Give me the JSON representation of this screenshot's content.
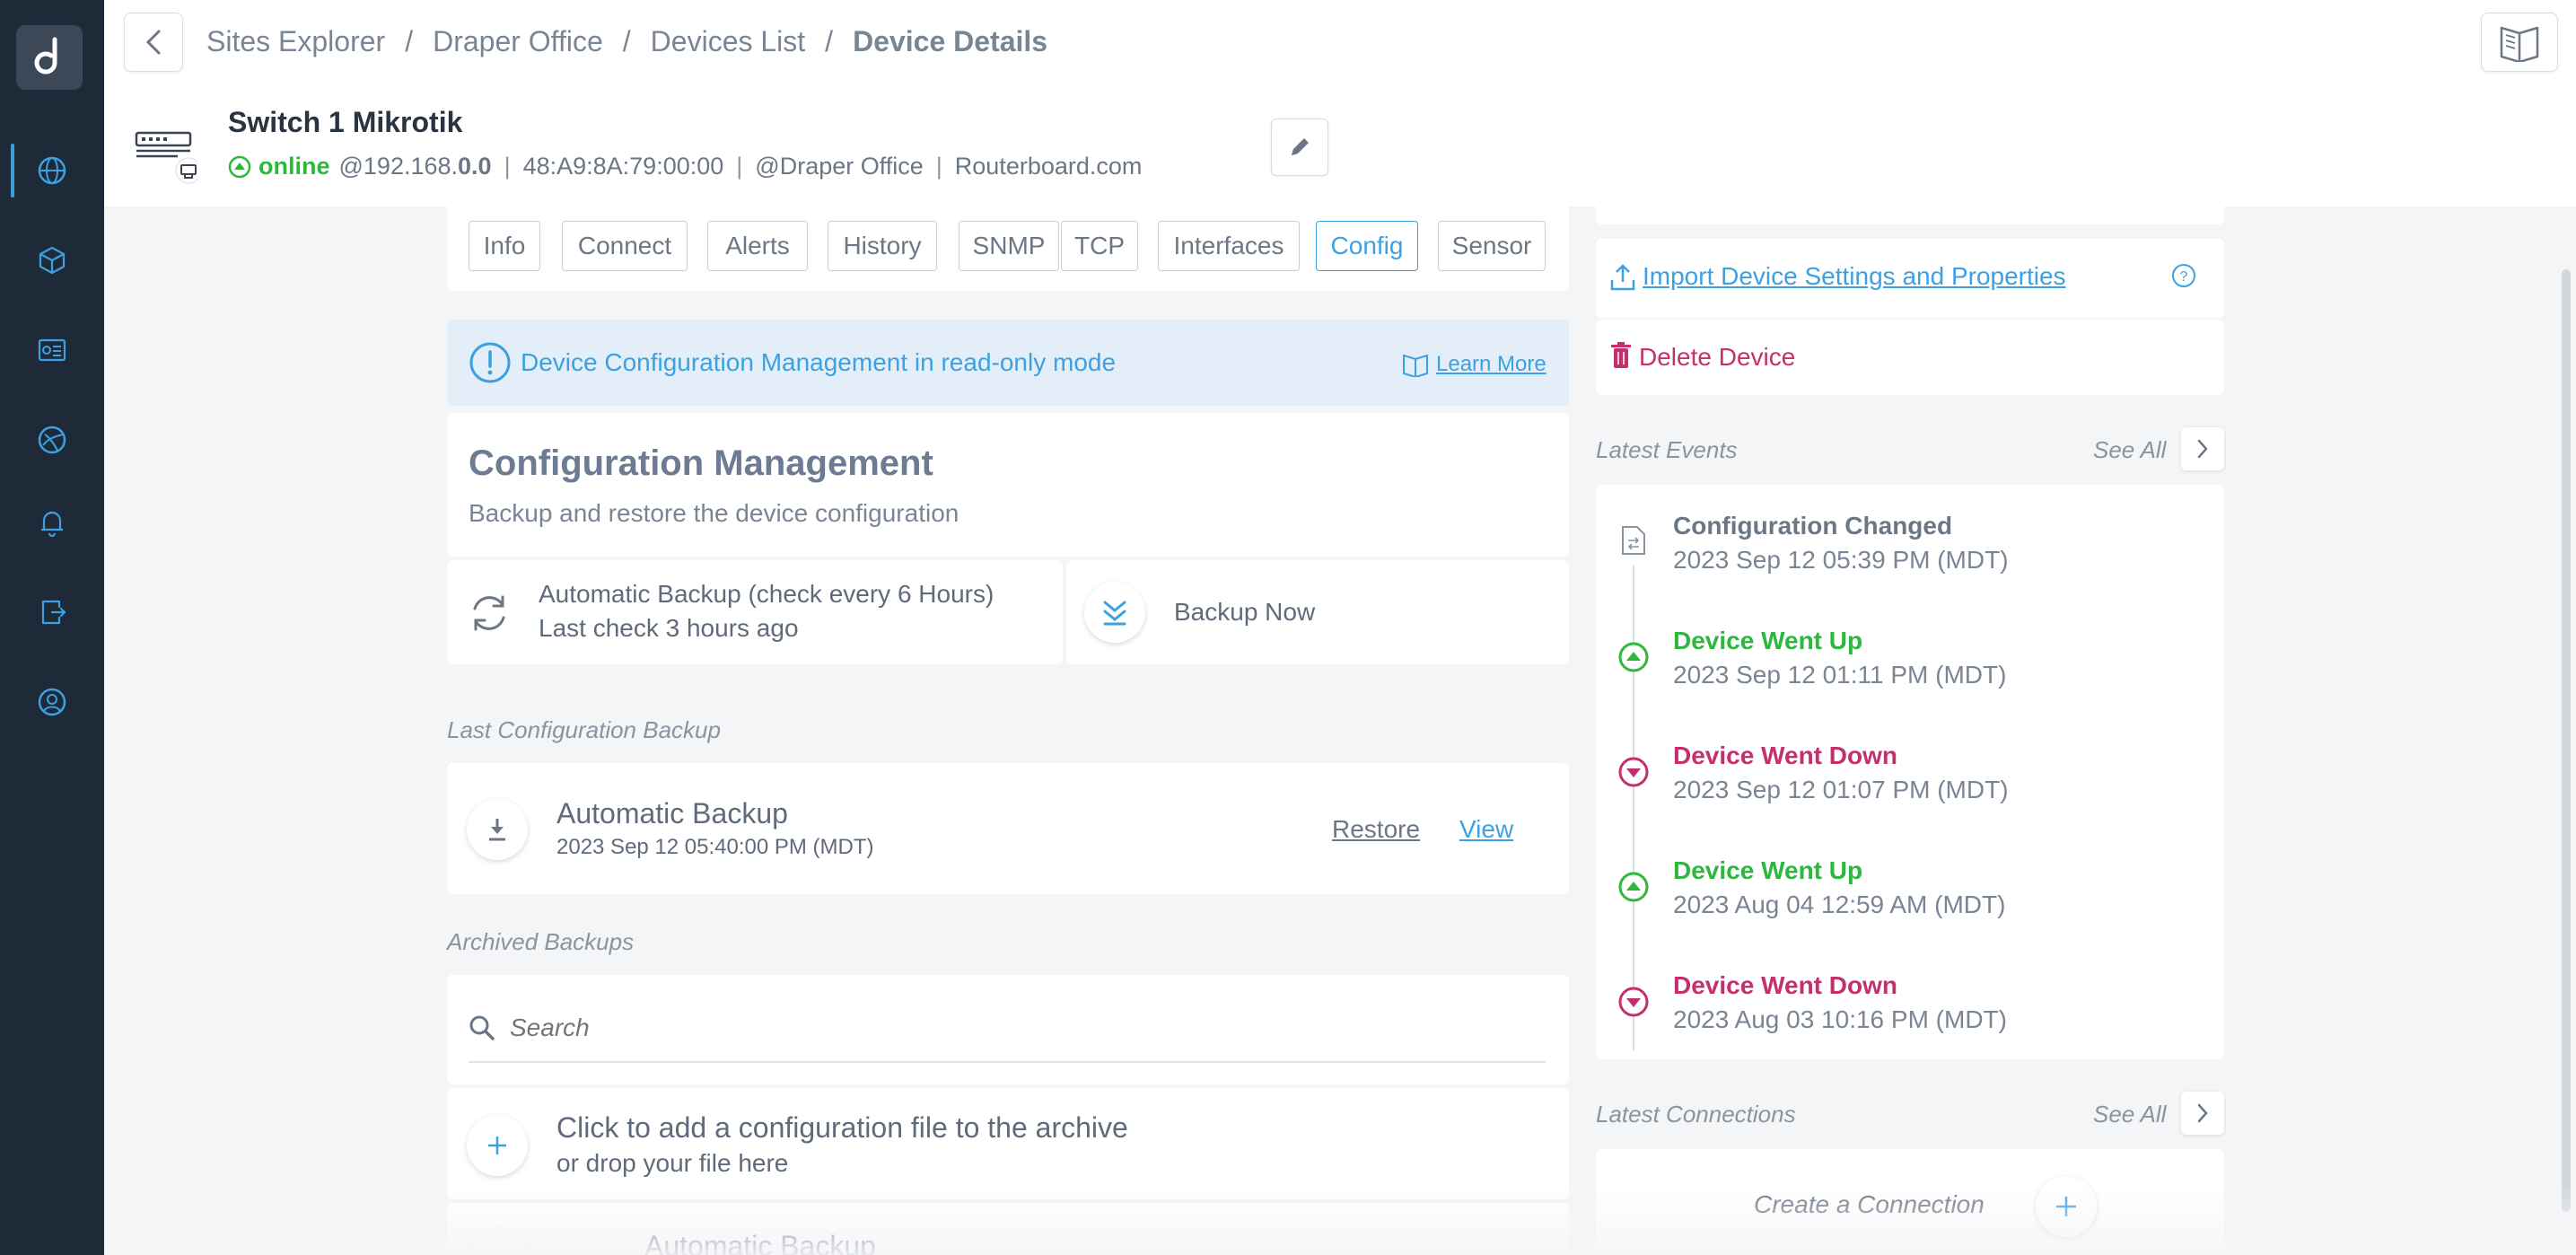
{
  "breadcrumb": {
    "items": [
      "Sites Explorer",
      "Draper Office",
      "Devices List"
    ],
    "separator": "/",
    "current": "Device Details"
  },
  "device": {
    "name": "Switch 1 Mikrotik",
    "status": "online",
    "ip_prefix": "@192.168.",
    "ip_suffix": "0.0",
    "mac": "48:A9:8A:79:00:00",
    "site_prefix": "@",
    "site": "Draper Office",
    "vendor": "Routerboard.com"
  },
  "tabs": [
    {
      "label": "Info"
    },
    {
      "label": "Connect"
    },
    {
      "label": "Alerts"
    },
    {
      "label": "History"
    },
    {
      "label": "SNMP"
    },
    {
      "label": "TCP"
    },
    {
      "label": "Interfaces"
    },
    {
      "label": "Config",
      "active": true
    },
    {
      "label": "Sensor"
    }
  ],
  "readonly": {
    "message": "Device Configuration Management in read-only mode",
    "learn_more": "Learn More"
  },
  "config": {
    "title": "Configuration Management",
    "subtitle": "Backup and restore the device configuration",
    "auto_backup": "Automatic Backup (check every 6 Hours)",
    "last_check": "Last check 3 hours ago",
    "backup_now": "Backup Now"
  },
  "last_backup": {
    "label": "Last Configuration Backup",
    "name": "Automatic Backup",
    "date": "2023 Sep 12 05:40:00 PM (MDT)",
    "restore": "Restore",
    "view": "View"
  },
  "archived": {
    "label": "Archived Backups",
    "search_placeholder": "Search",
    "add_title": "Click to add a configuration file to the archive",
    "add_sub": "or drop your file here",
    "partial_item": "Automatic Backup"
  },
  "actions": {
    "import": "Import Device Settings and Properties",
    "delete": "Delete Device"
  },
  "events": {
    "label": "Latest Events",
    "see_all": "See All",
    "items": [
      {
        "title": "Configuration Changed",
        "time": "2023 Sep 12 05:39 PM (MDT)",
        "kind": "config"
      },
      {
        "title": "Device Went Up",
        "time": "2023 Sep 12 01:11 PM (MDT)",
        "kind": "up"
      },
      {
        "title": "Device Went Down",
        "time": "2023 Sep 12 01:07 PM (MDT)",
        "kind": "down"
      },
      {
        "title": "Device Went Up",
        "time": "2023 Aug 04 12:59 AM (MDT)",
        "kind": "up"
      },
      {
        "title": "Device Went Down",
        "time": "2023 Aug 03 10:16 PM (MDT)",
        "kind": "down"
      }
    ]
  },
  "connections": {
    "label": "Latest Connections",
    "see_all": "See All",
    "create": "Create a Connection"
  },
  "colors": {
    "sidebar": "#1f2a38",
    "accent": "#3da0e0",
    "online": "#2db83d",
    "down": "#c4306d",
    "delete": "#c4306d"
  }
}
